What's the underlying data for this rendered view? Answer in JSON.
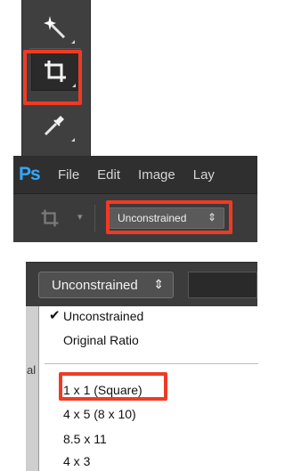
{
  "colors": {
    "highlight": "#f03a24",
    "ps_logo": "#31a8ff",
    "toolbar_bg": "#3f3f3f",
    "menubar_bg": "#2f2f2f",
    "optionsbar_bg": "#3b3b3b"
  },
  "toolbar": {
    "tools": [
      {
        "icon": "magic-wand-icon",
        "selected": false
      },
      {
        "icon": "crop-icon",
        "selected": true
      },
      {
        "icon": "eyedropper-icon",
        "selected": false
      }
    ]
  },
  "menubar": {
    "logo": "Ps",
    "items": [
      "File",
      "Edit",
      "Image",
      "Lay"
    ]
  },
  "options_bar": {
    "tool_icon": "crop-icon",
    "chevron": "▾",
    "ratio_select": "Unconstrained",
    "select_arrows": "⇕"
  },
  "dropdown": {
    "selected_value": "Unconstrained",
    "select_arrows": "⇕",
    "left_clip_text": "al",
    "checkmark": "✔",
    "items": [
      {
        "label": "Unconstrained",
        "checked": true
      },
      {
        "label": "Original Ratio",
        "checked": false
      },
      {
        "label": "1 x 1 (Square)",
        "checked": false,
        "highlighted": true
      },
      {
        "label": "4 x 5 (8 x 10)",
        "checked": false
      },
      {
        "label": "8.5 x 11",
        "checked": false
      },
      {
        "label": "4 x 3",
        "checked": false
      }
    ]
  }
}
